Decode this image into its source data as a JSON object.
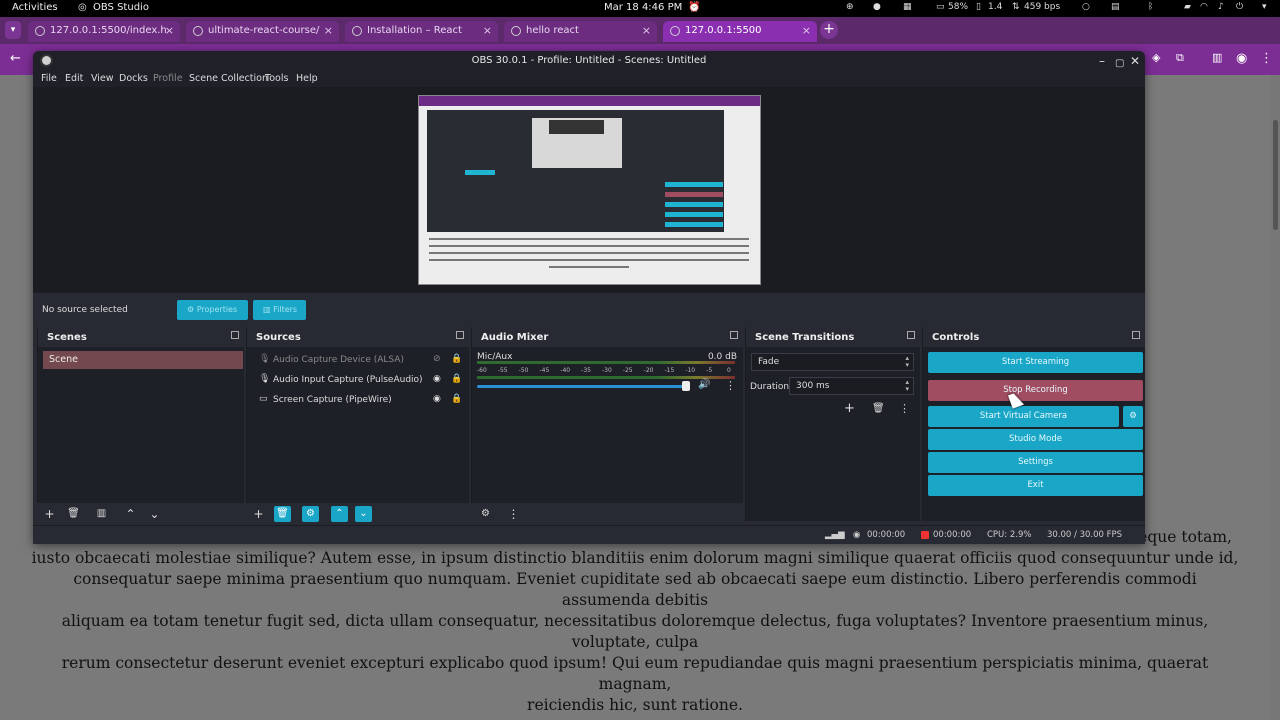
{
  "topbar": {
    "activities": "Activities",
    "app_name": "OBS Studio",
    "datetime": "Mar 18  4:46 PM",
    "battery": "58%",
    "load": "1.4",
    "network": "459 bps"
  },
  "browser": {
    "tabs": [
      {
        "title": "127.0.0.1:5500/index.h",
        "active": false
      },
      {
        "title": "ultimate-react-course/",
        "active": false
      },
      {
        "title": "Installation – React",
        "active": false
      },
      {
        "title": "hello react",
        "active": false
      },
      {
        "title": "127.0.0.1:5500",
        "active": true
      }
    ],
    "new_tab": "+"
  },
  "page": {
    "text_lines": [
      "eque totam,",
      "iusto obcaecati molestiae similique? Autem esse, in ipsum distinctio blanditiis enim dolorum magni similique quaerat officiis quod consequuntur unde id,",
      "consequatur saepe minima praesentium quo numquam. Eveniet cupiditate sed ab obcaecati saepe eum distinctio. Libero perferendis commodi assumenda debitis",
      "aliquam ea totam tenetur fugit sed, dicta ullam consequatur, necessitatibus doloremque delectus, fuga voluptates? Inventore praesentium minus, voluptate, culpa",
      "rerum consectetur deserunt eveniet excepturi explicabo quod ipsum! Qui eum repudiandae quis magni praesentium perspiciatis minima, quaerat magnam,",
      "reiciendis hic, sunt ratione."
    ]
  },
  "obs": {
    "title": "OBS 30.0.1 - Profile: Untitled - Scenes: Untitled",
    "menu": [
      "File",
      "Edit",
      "View",
      "Docks",
      "Profile",
      "Scene Collection",
      "Tools",
      "Help"
    ],
    "no_source": "No source selected",
    "properties_label": "Properties",
    "filters_label": "Filters",
    "scenes": {
      "title": "Scenes",
      "items": [
        "Scene"
      ]
    },
    "sources": {
      "title": "Sources",
      "items": [
        {
          "label": "Audio Capture Device (ALSA)",
          "enabled": false
        },
        {
          "label": "Audio Input Capture (PulseAudio)",
          "enabled": true
        },
        {
          "label": "Screen Capture (PipeWire)",
          "enabled": true
        }
      ]
    },
    "mixer": {
      "title": "Audio Mixer",
      "channel": "Mic/Aux",
      "db": "0.0 dB",
      "ticks": [
        "-60",
        "-55",
        "-50",
        "-45",
        "-40",
        "-35",
        "-30",
        "-25",
        "-20",
        "-15",
        "-10",
        "-5",
        "0"
      ],
      "volume_level": 0.97
    },
    "transitions": {
      "title": "Scene Transitions",
      "selected": "Fade",
      "duration_label": "Duration",
      "duration_value": "300 ms"
    },
    "controls": {
      "title": "Controls",
      "start_streaming": "Start Streaming",
      "stop_recording": "Stop Recording",
      "start_virtual_camera": "Start Virtual Camera",
      "studio_mode": "Studio Mode",
      "settings": "Settings",
      "exit": "Exit"
    },
    "status": {
      "stream_time": "00:00:00",
      "rec_time": "00:00:00",
      "cpu": "CPU: 2.9%",
      "fps": "30.00 / 30.00 FPS"
    }
  }
}
